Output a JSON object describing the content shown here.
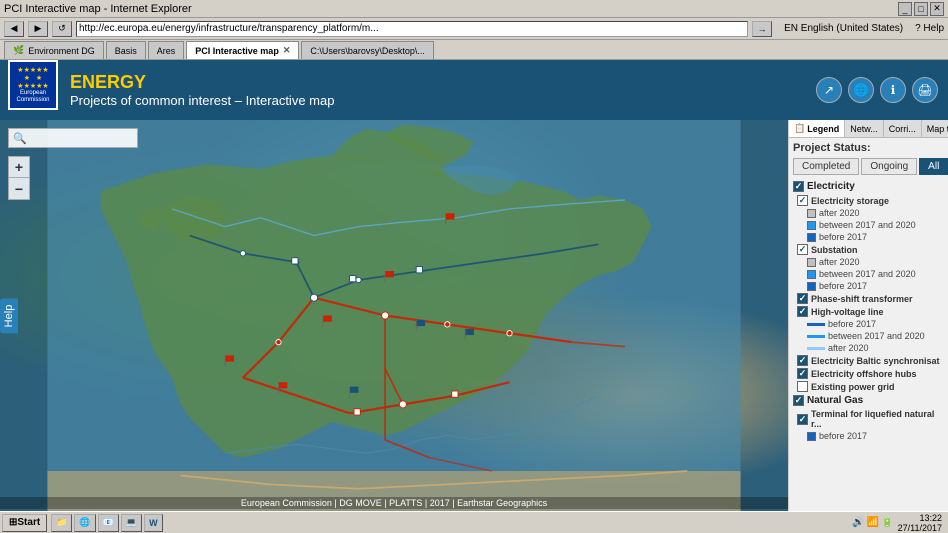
{
  "browser": {
    "title": "PCI Interactive map - Internet Explorer",
    "address": "http://ec.europa.eu/energy/infrastructure/transparency_platform/m...",
    "tabs": [
      {
        "label": "Environment DG",
        "active": false
      },
      {
        "label": "Basis",
        "active": false
      },
      {
        "label": "Ares",
        "active": false
      },
      {
        "label": "PCI Interactive map",
        "active": true
      },
      {
        "label": "C:\\Users\\barovsy\\Desktop\\...",
        "active": false
      }
    ],
    "lang": "EN English (United States)",
    "help": "? Help"
  },
  "header": {
    "energy_label": "ENERGY",
    "subtitle": "Projects of common interest – Interactive map",
    "logo_line1": "European",
    "logo_line2": "Commission"
  },
  "map": {
    "search_placeholder": "",
    "zoom_in": "+",
    "zoom_out": "−",
    "help_btn": "Help",
    "attribution": "European Commission | DG MOVE | PLATTS | 2017 | Earthstar Geographics"
  },
  "panel": {
    "tabs": [
      {
        "label": "Legend",
        "icon": "📋",
        "active": true
      },
      {
        "label": "Netw...",
        "icon": "🌐",
        "active": false
      },
      {
        "label": "Corri...",
        "icon": "📁",
        "active": false
      },
      {
        "label": "Map t...",
        "icon": "🗺",
        "active": false
      }
    ],
    "project_status_label": "Project Status:",
    "status_buttons": [
      {
        "label": "Completed",
        "active": false
      },
      {
        "label": "Ongoing",
        "active": false
      },
      {
        "label": "All",
        "active": true
      }
    ],
    "sections": [
      {
        "id": "electricity",
        "label": "Electricity",
        "checked": true,
        "items": [
          {
            "id": "electricity-storage",
            "label": "Electricity storage",
            "checked": true,
            "subitems": [
              {
                "label": "after 2020",
                "color": "#c0c0c0"
              },
              {
                "label": "between 2017 and 2020",
                "color": "#2196F3"
              },
              {
                "label": "before 2017",
                "color": "#1565C0"
              }
            ]
          },
          {
            "id": "substation",
            "label": "Substation",
            "checked": true,
            "subitems": [
              {
                "label": "after 2020",
                "color": "#c0c0c0"
              },
              {
                "label": "between 2017 and 2020",
                "color": "#2196F3"
              },
              {
                "label": "before 2017",
                "color": "#1565C0"
              }
            ]
          },
          {
            "id": "phase-shift",
            "label": "Phase-shift transformer",
            "checked": true,
            "subitems": []
          },
          {
            "id": "high-voltage",
            "label": "High-voltage line",
            "checked": true,
            "subitems": [
              {
                "label": "before 2017",
                "lineColor": "#1565C0"
              },
              {
                "label": "between 2017 and 2020",
                "lineColor": "#2196F3"
              },
              {
                "label": "after 2020",
                "lineColor": "#90CAF9"
              }
            ]
          },
          {
            "id": "baltic-sync",
            "label": "Electricity Baltic synchronisat",
            "checked": true,
            "subitems": []
          },
          {
            "id": "offshore-hubs",
            "label": "Electricity offshore hubs",
            "checked": true,
            "subitems": []
          },
          {
            "id": "existing-power",
            "label": "Existing power grid",
            "checked": false,
            "subitems": []
          }
        ]
      },
      {
        "id": "natural-gas",
        "label": "Natural Gas",
        "checked": true,
        "items": [
          {
            "id": "terminal-lng",
            "label": "Terminal for liquefied natural r...",
            "checked": true,
            "subitems": [
              {
                "label": "before 2017",
                "color": "#1565C0"
              }
            ]
          }
        ]
      }
    ]
  },
  "taskbar": {
    "start": "Start",
    "apps": [
      {
        "label": "Start",
        "icon": "⊞"
      },
      {
        "label": "",
        "icon": "📁"
      },
      {
        "label": "",
        "icon": "🌐"
      },
      {
        "label": "",
        "icon": "📧"
      },
      {
        "label": "",
        "icon": "💻"
      },
      {
        "label": "",
        "icon": "W"
      }
    ],
    "time": "13:22",
    "date": "27/11/2017"
  }
}
